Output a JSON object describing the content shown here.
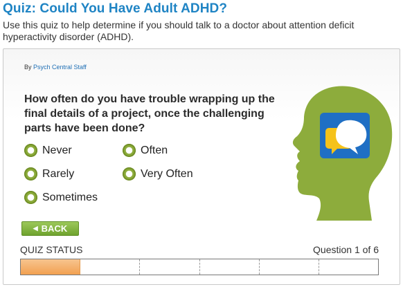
{
  "header": {
    "title": "Quiz: Could You Have Adult ADHD?",
    "intro": "Use this quiz to help determine if you should talk to a doctor about attention deficit hyperactivity disorder (ADHD)."
  },
  "quiz": {
    "byline_prefix": "By",
    "author": "Psych Central Staff",
    "question": "How often do you have trouble wrapping up the final details of a project, once the challenging parts have been done?",
    "options": [
      "Never",
      "Often",
      "Rarely",
      "Very Often",
      "Sometimes"
    ],
    "back_label": "BACK",
    "status_label": "QUIZ STATUS",
    "question_count": "Question 1 of 6",
    "progress": {
      "current": 1,
      "total": 6
    }
  },
  "colors": {
    "title_blue": "#1f84c4",
    "accent_green": "#8dac3c",
    "progress_orange": "#f2a151"
  }
}
